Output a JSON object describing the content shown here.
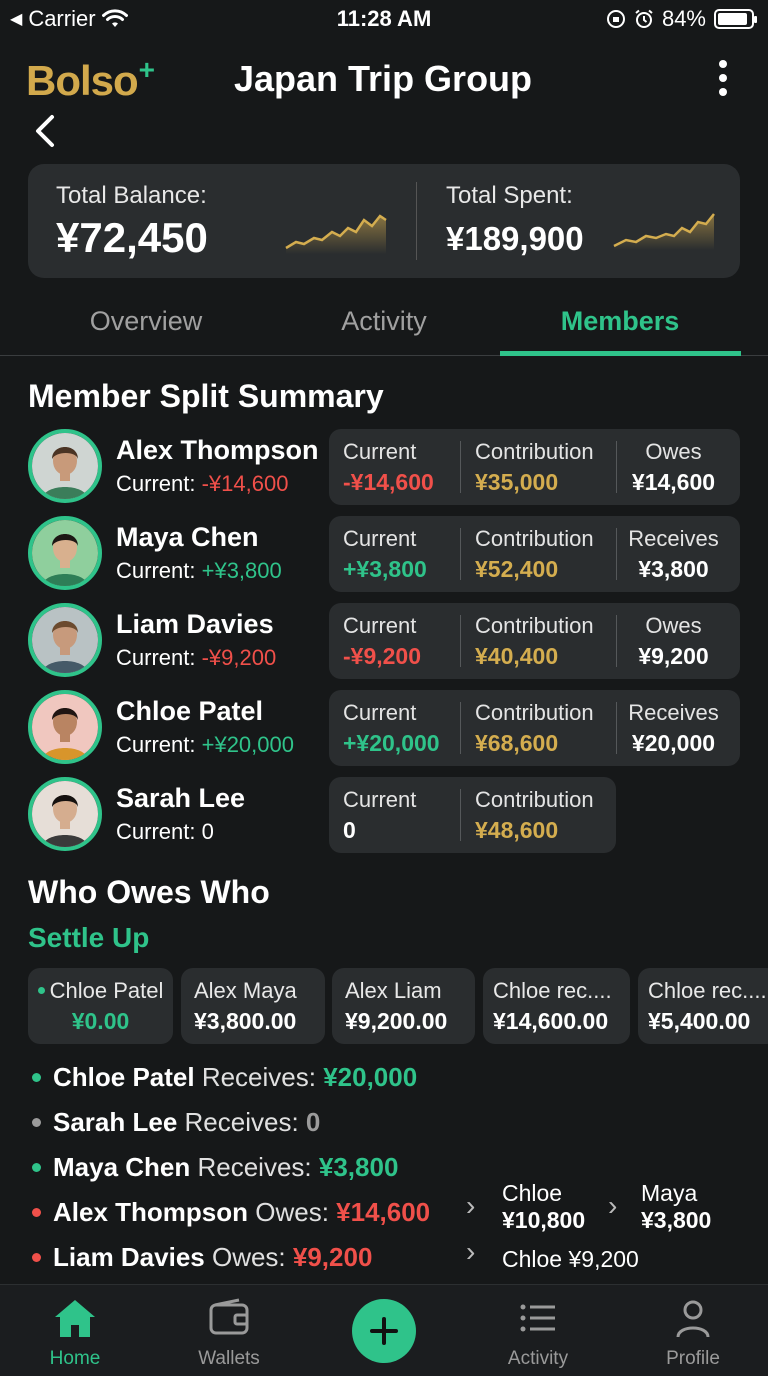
{
  "status_bar": {
    "carrier": "Carrier",
    "time": "11:28 AM",
    "battery": "84%"
  },
  "header": {
    "logo": "Bolso",
    "logo_plus": "+",
    "title": "Japan Trip Group"
  },
  "summary": {
    "balance_label": "Total Balance:",
    "balance_value": "¥72,450",
    "spent_label": "Total Spent:",
    "spent_value": "¥189,900"
  },
  "tabs": [
    {
      "label": "Overview",
      "active": false
    },
    {
      "label": "Activity",
      "active": false
    },
    {
      "label": "Members",
      "active": true
    }
  ],
  "member_section_title": "Member Split Summary",
  "members": [
    {
      "name": "Alex Thompson",
      "current_label": "Current:",
      "current": "-¥14,600",
      "tone": "red",
      "cols": [
        {
          "label": "Current",
          "value": "-¥14,600"
        },
        {
          "label": "Contribution",
          "value": "¥35,000"
        },
        {
          "label": "Owes",
          "value": "¥14,600"
        }
      ]
    },
    {
      "name": "Maya Chen",
      "current_label": "Current:",
      "current": "+¥3,800",
      "tone": "green",
      "cols": [
        {
          "label": "Current",
          "value": "+¥3,800"
        },
        {
          "label": "Contribution",
          "value": "¥52,400"
        },
        {
          "label": "Receives",
          "value": "¥3,800"
        }
      ]
    },
    {
      "name": "Liam Davies",
      "current_label": "Current:",
      "current": "-¥9,200",
      "tone": "red",
      "cols": [
        {
          "label": "Current",
          "value": "-¥9,200"
        },
        {
          "label": "Contribution",
          "value": "¥40,400"
        },
        {
          "label": "Owes",
          "value": "¥9,200"
        }
      ]
    },
    {
      "name": "Chloe Patel",
      "current_label": "Current:",
      "current": "+¥20,000",
      "tone": "green",
      "cols": [
        {
          "label": "Current",
          "value": "+¥20,000"
        },
        {
          "label": "Contribution",
          "value": "¥68,600"
        },
        {
          "label": "Receives",
          "value": "¥20,000"
        }
      ]
    },
    {
      "name": "Sarah Lee",
      "current_label": "Current:",
      "current": "0",
      "tone": "white",
      "cols": [
        {
          "label": "Current",
          "value": "0"
        },
        {
          "label": "Contribution",
          "value": "¥48,600"
        }
      ]
    }
  ],
  "owes_title": "Who Owes Who",
  "settle_title": "Settle Up",
  "settle_chips": [
    {
      "name": "Chloe Patel",
      "value": "¥0.00"
    },
    {
      "name": "Alex Maya",
      "value": "¥3,800.00"
    },
    {
      "name": "Alex Liam",
      "value": "¥9,200.00"
    },
    {
      "name": "Chloe rec....",
      "value": "¥14,600.00"
    },
    {
      "name": "Chloe rec....",
      "value": "¥5,400.00"
    }
  ],
  "settlements": [
    {
      "name": "Chloe Patel",
      "action": " Receives: ",
      "amount": "¥20,000"
    },
    {
      "name": "Sarah Lee",
      "action": " Receives: ",
      "amount": "0"
    },
    {
      "name": "Maya Chen",
      "action": " Receives: ",
      "amount": "¥3,800"
    },
    {
      "name": "Alex Thompson",
      "action": " Owes: ",
      "amount": "¥14,600",
      "payees": [
        {
          "name": "Chloe",
          "amount": "¥10,800"
        },
        {
          "name": "Maya",
          "amount": "¥3,800"
        }
      ]
    },
    {
      "name": "Liam Davies",
      "action": " Owes: ",
      "amount": "¥9,200",
      "payee_inline": "Chloe ¥9,200"
    }
  ],
  "nav": [
    {
      "label": "Home",
      "icon": "home-icon",
      "active": true
    },
    {
      "label": "Wallets",
      "icon": "wallet-icon",
      "active": false
    },
    {
      "label": "Activity",
      "icon": "list-icon",
      "active": false
    },
    {
      "label": "Profile",
      "icon": "person-icon",
      "active": false
    }
  ],
  "colors": {
    "accent": "#2fc38a",
    "negative": "#f0504a",
    "gold": "#d4ad4f",
    "background": "#161819",
    "card": "#2a2d2f"
  }
}
